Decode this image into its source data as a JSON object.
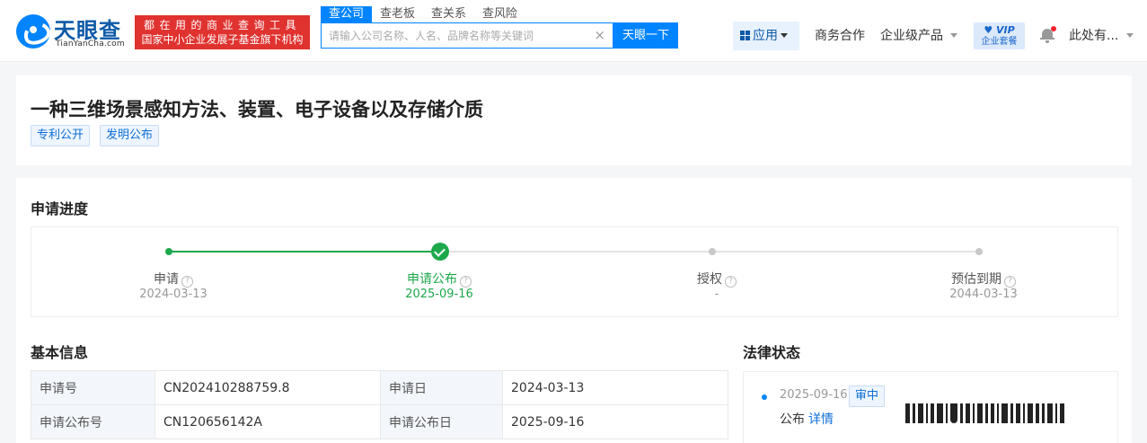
{
  "header": {
    "logo": {
      "name": "天眼查",
      "sub": "TianYanCha.com"
    },
    "slogan": {
      "line1": "都在用的商业查询工具",
      "line2": "国家中小企业发展子基金旗下机构"
    },
    "search": {
      "tabs": [
        "查公司",
        "查老板",
        "查关系",
        "查风险"
      ],
      "placeholder": "请输入公司名称、人名、品牌名称等关键词",
      "value": "",
      "button": "天眼一下"
    },
    "nav": {
      "apps": "应用",
      "business": "商务合作",
      "enterprise": "企业级产品",
      "vip_line1": "VIP",
      "vip_line2": "企业套餐",
      "user": "此处有..."
    }
  },
  "patent": {
    "title": "一种三维场景感知方法、装置、电子设备以及存储介质",
    "tags": [
      "专利公开",
      "发明公布"
    ]
  },
  "progress": {
    "heading": "申请进度",
    "steps": [
      {
        "label": "申请",
        "date": "2024-03-13",
        "state": "done"
      },
      {
        "label": "申请公布",
        "date": "2025-09-16",
        "state": "current"
      },
      {
        "label": "授权",
        "date": "-",
        "state": "pending"
      },
      {
        "label": "预估到期",
        "date": "2044-03-13",
        "state": "pending"
      }
    ]
  },
  "basic_info": {
    "heading": "基本信息",
    "rows": [
      {
        "k1": "申请号",
        "v1": "CN202410288759.8",
        "k2": "申请日",
        "v2": "2024-03-13"
      },
      {
        "k1": "申请公布号",
        "v1": "CN120656142A",
        "k2": "申请公布日",
        "v2": "2025-09-16"
      }
    ]
  },
  "legal_status": {
    "heading": "法律状态",
    "entries": [
      {
        "date": "2025-09-16",
        "badge": "审中",
        "text": "公布",
        "link": "详情"
      }
    ]
  },
  "colors": {
    "brand": "#0084ff",
    "success": "#1ea84c",
    "slogan_bg": "#e0322f"
  },
  "icons": [
    "logo-icon",
    "clear-icon",
    "apps-grid-icon",
    "caret-down-icon",
    "bell-icon",
    "help-icon",
    "check-icon"
  ]
}
